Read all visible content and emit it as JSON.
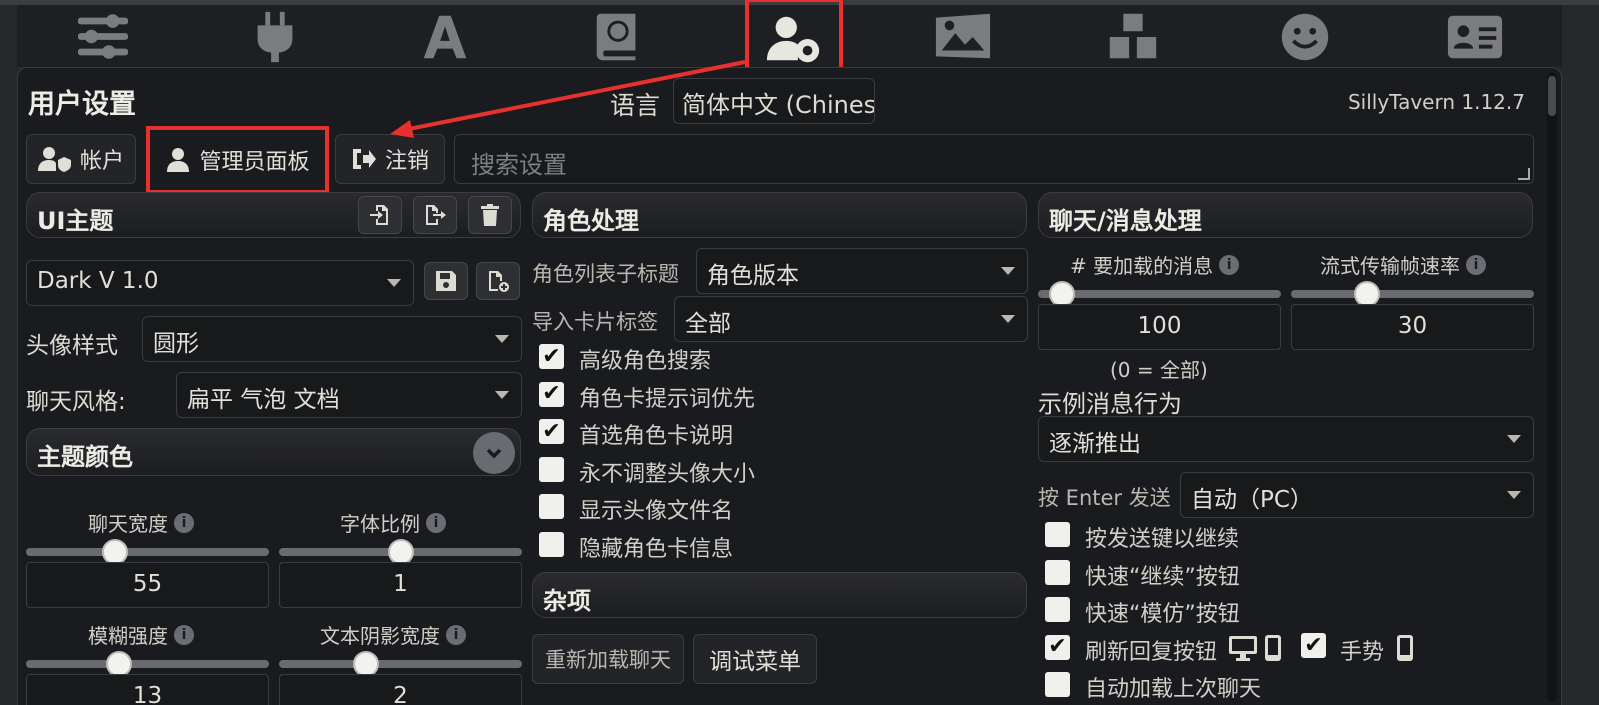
{
  "nav": {
    "icons": [
      "sliders-icon",
      "plug-icon",
      "font-icon",
      "book-globe-icon",
      "user-gear-icon",
      "landscape-icon",
      "cubes-icon",
      "smiley-icon",
      "id-card-icon"
    ]
  },
  "header": {
    "title": "用户设置",
    "language_label": "语言",
    "language_value": "简体中文 (Chinese)",
    "version": "SillyTavern 1.12.7"
  },
  "account_buttons": {
    "account": "帐户",
    "admin_panel": "管理员面板",
    "logout": "注销",
    "search_placeholder": "搜索设置"
  },
  "ui_theme": {
    "section_title": "UI主题",
    "theme_value": "Dark V 1.0",
    "avatar_style_label": "头像样式",
    "avatar_style_value": "圆形",
    "chat_style_label": "聊天风格:",
    "chat_style_value": "扁平 气泡 文档",
    "theme_colors": "主题颜色",
    "chat_width_label": "聊天宽度",
    "chat_width_value": "55",
    "chat_width_level": 0.35,
    "font_scale_label": "字体比例",
    "font_scale_value": "1",
    "font_scale_level": 0.5,
    "blur_label": "模糊强度",
    "blur_value": "13",
    "blur_level": 0.37,
    "text_shadow_label": "文本阴影宽度",
    "text_shadow_value": "2",
    "text_shadow_level": 0.34
  },
  "character": {
    "section_title": "角色处理",
    "list_subtitle_label": "角色列表子标题",
    "list_subtitle_value": "角色版本",
    "import_tags_label": "导入卡片标签",
    "import_tags_value": "全部",
    "checkboxes": [
      {
        "label": "高级角色搜索",
        "checked": true
      },
      {
        "label": "角色卡提示词优先",
        "checked": true
      },
      {
        "label": "首选角色卡说明",
        "checked": true
      },
      {
        "label": "永不调整头像大小",
        "checked": false
      },
      {
        "label": "显示头像文件名",
        "checked": false
      },
      {
        "label": "隐藏角色卡信息",
        "checked": false
      }
    ],
    "misc_title": "杂项",
    "reload_chat": "重新加载聊天",
    "debug_menu": "调试菜单"
  },
  "chat": {
    "section_title": "聊天/消息处理",
    "messages_label": "# 要加载的消息",
    "messages_value": "100",
    "messages_level": 0.05,
    "messages_hint": "(0 = 全部)",
    "stream_fps_label": "流式传输帧速率",
    "stream_fps_value": "30",
    "stream_fps_level": 0.29,
    "example_behavior_label": "示例消息行为",
    "example_behavior_value": "逐渐推出",
    "enter_send_label": "按 Enter 发送",
    "enter_send_value": "自动（PC）",
    "checkboxes": [
      {
        "label": "按发送键以继续",
        "checked": false
      },
      {
        "label": "快速“继续”按钮",
        "checked": false
      },
      {
        "label": "快速“模仿”按钮",
        "checked": false
      },
      {
        "label": "刷新回复按钮",
        "checked": true
      },
      {
        "label": "自动加载上次聊天",
        "checked": false
      }
    ],
    "gesture_label": "手势",
    "gesture_checked": true
  },
  "colors": {
    "highlight": "#e8312e"
  }
}
